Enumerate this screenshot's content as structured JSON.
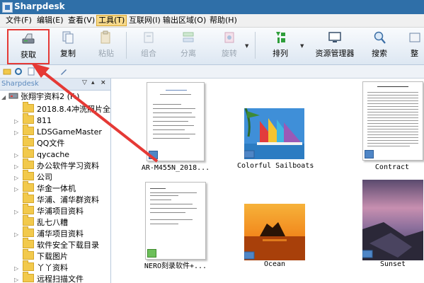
{
  "window": {
    "title": "Sharpdesk"
  },
  "menu": [
    "文件(F)",
    "编辑(E)",
    "查看(V)",
    "工具(T)",
    "互联网(I)",
    "输出区域(O)",
    "帮助(H)"
  ],
  "toolbar": {
    "acquire": "获取",
    "copy": "复制",
    "paste": "粘贴",
    "combine": "组合",
    "split": "分离",
    "rotate": "旋转",
    "arrange": "排列",
    "resource_manager": "资源管理器",
    "search": "搜索",
    "more": "整"
  },
  "sidebar": {
    "header": "Sharpdesk",
    "root": "张翔宇资料2 (F:)",
    "items": [
      "2018.8.4冲洗照片全",
      "811",
      "LDSGameMaster",
      "QQ文件",
      "qycache",
      "办公软件学习资料",
      "公司",
      "华金一体机",
      "华浦、浦华群资料",
      "华浦项目资料",
      "乱七八糟",
      "浦华项目资料",
      "软件安全下载目录",
      "下载图片",
      "丫丫资料",
      "远程扫描文件"
    ]
  },
  "files": [
    {
      "name": "AR-M455N_2018...",
      "kind": "document"
    },
    {
      "name": "Colorful Sailboats",
      "kind": "image"
    },
    {
      "name": "Contract",
      "kind": "document"
    },
    {
      "name": "NERO刻录软件+...",
      "kind": "document"
    },
    {
      "name": "Ocean",
      "kind": "image"
    },
    {
      "name": "Sunset",
      "kind": "image"
    }
  ],
  "colors": {
    "titlebar": "#2f6fa8",
    "highlight": "#e53935",
    "menu_active": "#f7d98a"
  }
}
